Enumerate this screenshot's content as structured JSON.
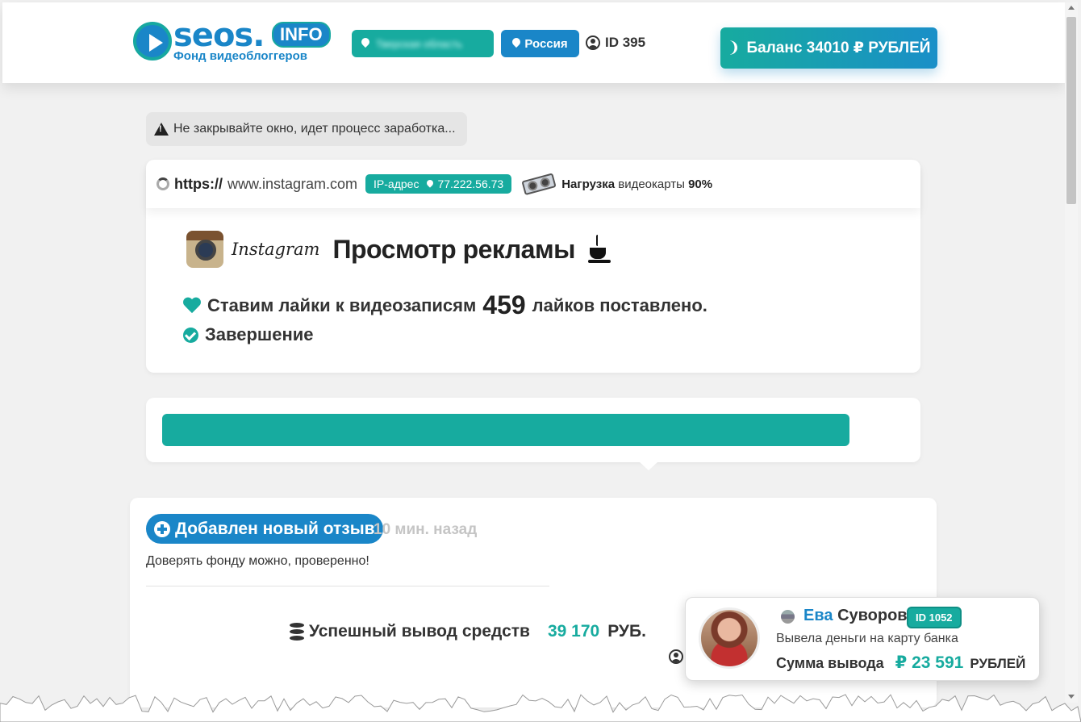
{
  "header": {
    "logo_text": "seos.",
    "logo_badge": "INFO",
    "logo_sub": "Фонд видеоблоггеров",
    "region": "Тверская область",
    "country": "Россия",
    "user_id": "ID 395",
    "balance_label": "Баланс 34010 ₽ РУБЛЕЙ"
  },
  "notice": {
    "text": "Не закрывайте окно, идет процесс заработка..."
  },
  "task": {
    "url_scheme": "https://",
    "url_host": "www.instagram.com",
    "ip_label": "IP-адрес",
    "ip_value": "77.222.56.73",
    "gpu_label": "Нагрузка",
    "gpu_text": "видеокарты",
    "gpu_value": "90%",
    "brand_word": "Instagram",
    "title": "Просмотр рекламы",
    "likes_prefix": "Ставим лайки к видеозаписям",
    "likes_count": "459",
    "likes_suffix": "лайков поставлено.",
    "done_label": "Завершение"
  },
  "progress": {
    "fraction": 0.926
  },
  "review": {
    "badge": "Добавлен новый отзыв",
    "time": "10 мин. назад",
    "text": "Доверять фонду можно, проверенно!",
    "withdraw_label": "Успешный вывод средств",
    "withdraw_amount": "39 170",
    "withdraw_currency": "РУБ."
  },
  "toast": {
    "first_name": "Ева",
    "last_name": "Суворова",
    "id": "ID 1052",
    "line1": "Вывела деньги на карту банка",
    "sum_label": "Сумма вывода",
    "sum_value": "₽ 23 591",
    "sum_currency": "РУБЛЕЙ"
  },
  "colors": {
    "teal": "#17ab9f",
    "blue": "#1a86c8",
    "background": "#f1f1f1"
  }
}
